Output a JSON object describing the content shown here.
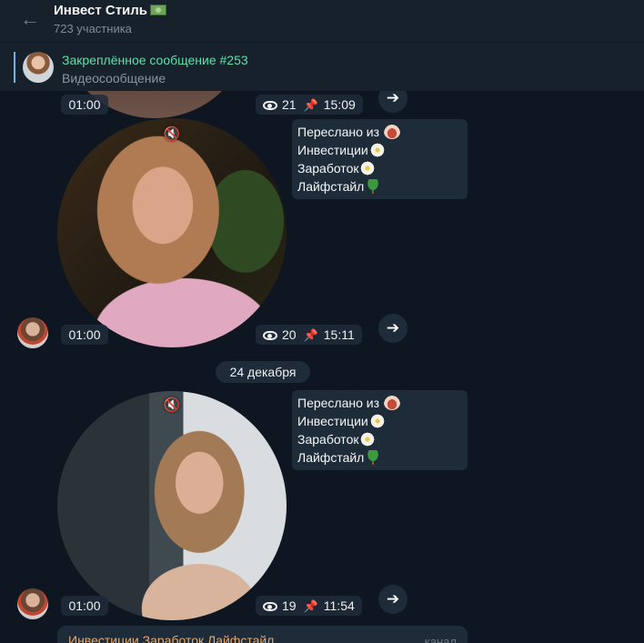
{
  "header": {
    "title": "Инвест Стиль",
    "title_icon": "money-emoji-icon",
    "subtitle": "723 участника"
  },
  "pinned": {
    "title": "Закреплённое сообщение #253",
    "text": "Видеосообщение"
  },
  "messages": [
    {
      "duration": "01:00",
      "views": "21",
      "time": "15:09"
    },
    {
      "duration": "01:00",
      "views": "20",
      "time": "15:11",
      "forward": [
        "Переслано из",
        "Инвестиции",
        "Заработок",
        "Лайфстайл"
      ]
    },
    {
      "duration": "01:00",
      "views": "19",
      "time": "11:54",
      "forward": [
        "Переслано из",
        "Инвестиции",
        "Заработок",
        "Лайфстайл"
      ]
    }
  ],
  "date_separator": "24 декабря",
  "bottom_message": {
    "text": "Инвестиции   Заработок   Лайфстайл",
    "channel": "канал"
  },
  "colors": {
    "background": "#0e1621",
    "header": "#17212b",
    "pinned_title": "#5fe0a8",
    "bubble": "#1e2c3a"
  }
}
